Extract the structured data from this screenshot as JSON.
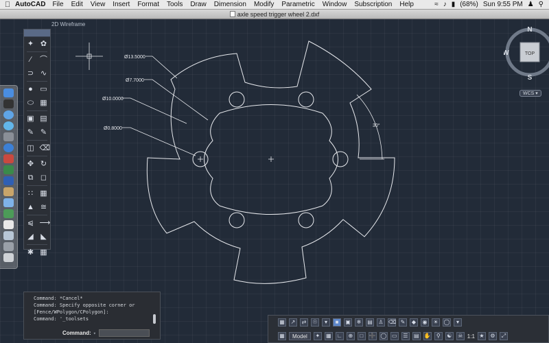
{
  "menubar": {
    "app_name": "AutoCAD",
    "items": [
      "File",
      "Edit",
      "View",
      "Insert",
      "Format",
      "Tools",
      "Draw",
      "Dimension",
      "Modify",
      "Parametric",
      "Window",
      "Subscription",
      "Help"
    ],
    "battery": "(68%)",
    "clock": "Sun 9:55 PM"
  },
  "window": {
    "title": "axle speed trigger wheel 2.dxf"
  },
  "viewport": {
    "label": "2D Wireframe"
  },
  "drawing": {
    "dimensions": [
      "Ø13.5000",
      "Ø7.7000",
      "Ø10.0000",
      "Ø0.8000"
    ],
    "angle": "30°"
  },
  "navcube": {
    "top": "TOP",
    "north": "N",
    "south": "S",
    "west": "W",
    "wcs": "WCS"
  },
  "command": {
    "history": [
      "Command: *Cancel*",
      "Command: Specify opposite corner or",
      "[Fence/WPolygon/CPolygon]:",
      "Command: '_toolsets"
    ],
    "prompt": "Command:",
    "value": ""
  },
  "status": {
    "model": "Model",
    "scale": "1:1"
  },
  "colors": {
    "geometry": "#e8eaee",
    "background": "#222b38",
    "accent": "#5a6a86"
  }
}
